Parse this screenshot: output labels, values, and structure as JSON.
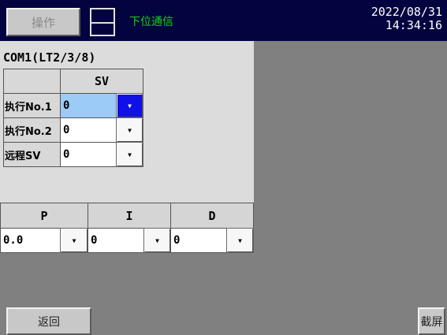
{
  "header": {
    "operate_label": "操作",
    "comm_label": "下位通信",
    "date": "2022/08/31",
    "time": "14:34:16"
  },
  "panel": {
    "com_label": "COM1(LT2/3/8)",
    "sv_header": "SV",
    "rows": [
      {
        "label": "执行No.1",
        "value": "0"
      },
      {
        "label": "执行No.2",
        "value": "0"
      },
      {
        "label": "远程SV",
        "value": "0"
      }
    ]
  },
  "pid": {
    "headers": [
      "P",
      "I",
      "D"
    ],
    "values": [
      "0.0",
      "0",
      "0"
    ]
  },
  "footer": {
    "back_label": "返回",
    "screenshot_label": "截屏"
  },
  "icons": {
    "dropdown": "triangle-down",
    "storage": "disk-icon"
  },
  "colors": {
    "header_bg": "#03033f",
    "comm_text": "#12d512",
    "selected_value": "#9ccbf7",
    "active_dropdown": "#1010e8"
  }
}
